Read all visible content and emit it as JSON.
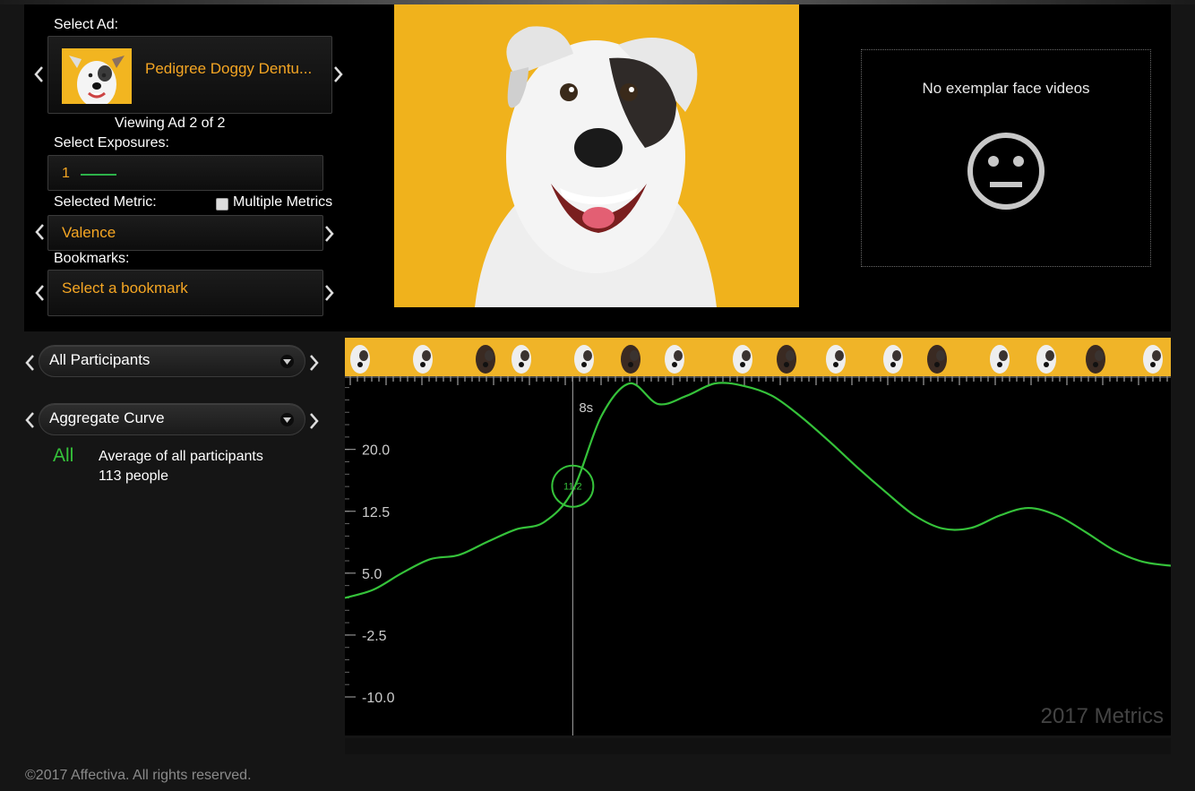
{
  "select_ad": {
    "label": "Select Ad:",
    "ad_title": "Pedigree Doggy Dentu...",
    "viewing": "Viewing Ad 2 of 2"
  },
  "exposures": {
    "label": "Select Exposures:",
    "value": "1",
    "line_color": "#2db24a"
  },
  "metric": {
    "label": "Selected Metric:",
    "multiple_label": "Multiple Metrics",
    "multiple_checked": false,
    "value": "Valence"
  },
  "bookmarks": {
    "label": "Bookmarks:",
    "value": "Select a bookmark"
  },
  "exemplar": {
    "text": "No exemplar face videos",
    "icon": "neutral-face-icon"
  },
  "participants": {
    "value": "All Participants"
  },
  "curve": {
    "value": "Aggregate Curve"
  },
  "legend": {
    "tag": "All",
    "line1": "Average of all participants",
    "line2": "113 people"
  },
  "chart_data": {
    "type": "line",
    "watermark": "2017 Metrics",
    "cursor_label": "8s",
    "cursor_value": "11.2",
    "y_ticks": [
      20.0,
      12.5,
      5.0,
      -2.5,
      -10.0
    ],
    "y_tick_labels": [
      "20.0",
      "12.5",
      "5.0",
      "-2.5",
      "-10.0"
    ],
    "series": [
      {
        "color": "#35c23a",
        "x": [
          0,
          1,
          2,
          3,
          4,
          5,
          6,
          7,
          8,
          9,
          10,
          11,
          12,
          13,
          14,
          15,
          16,
          17,
          18,
          19,
          20,
          21,
          22,
          23,
          24,
          25,
          26,
          27,
          28,
          29
        ],
        "values": [
          2.0,
          3.0,
          5.0,
          6.7,
          7.2,
          8.8,
          10.3,
          11.2,
          15.0,
          24.0,
          28.0,
          25.5,
          26.5,
          28.0,
          27.7,
          26.5,
          24.0,
          21.0,
          17.8,
          14.8,
          12.0,
          10.4,
          10.5,
          12.0,
          12.9,
          12.0,
          10.0,
          7.8,
          6.4,
          5.9
        ]
      }
    ],
    "cursor_x": 8,
    "ylim": [
      -10.0,
      28.0
    ],
    "xlim": [
      0,
      29
    ]
  },
  "footer": "©2017 Affectiva. All rights reserved."
}
